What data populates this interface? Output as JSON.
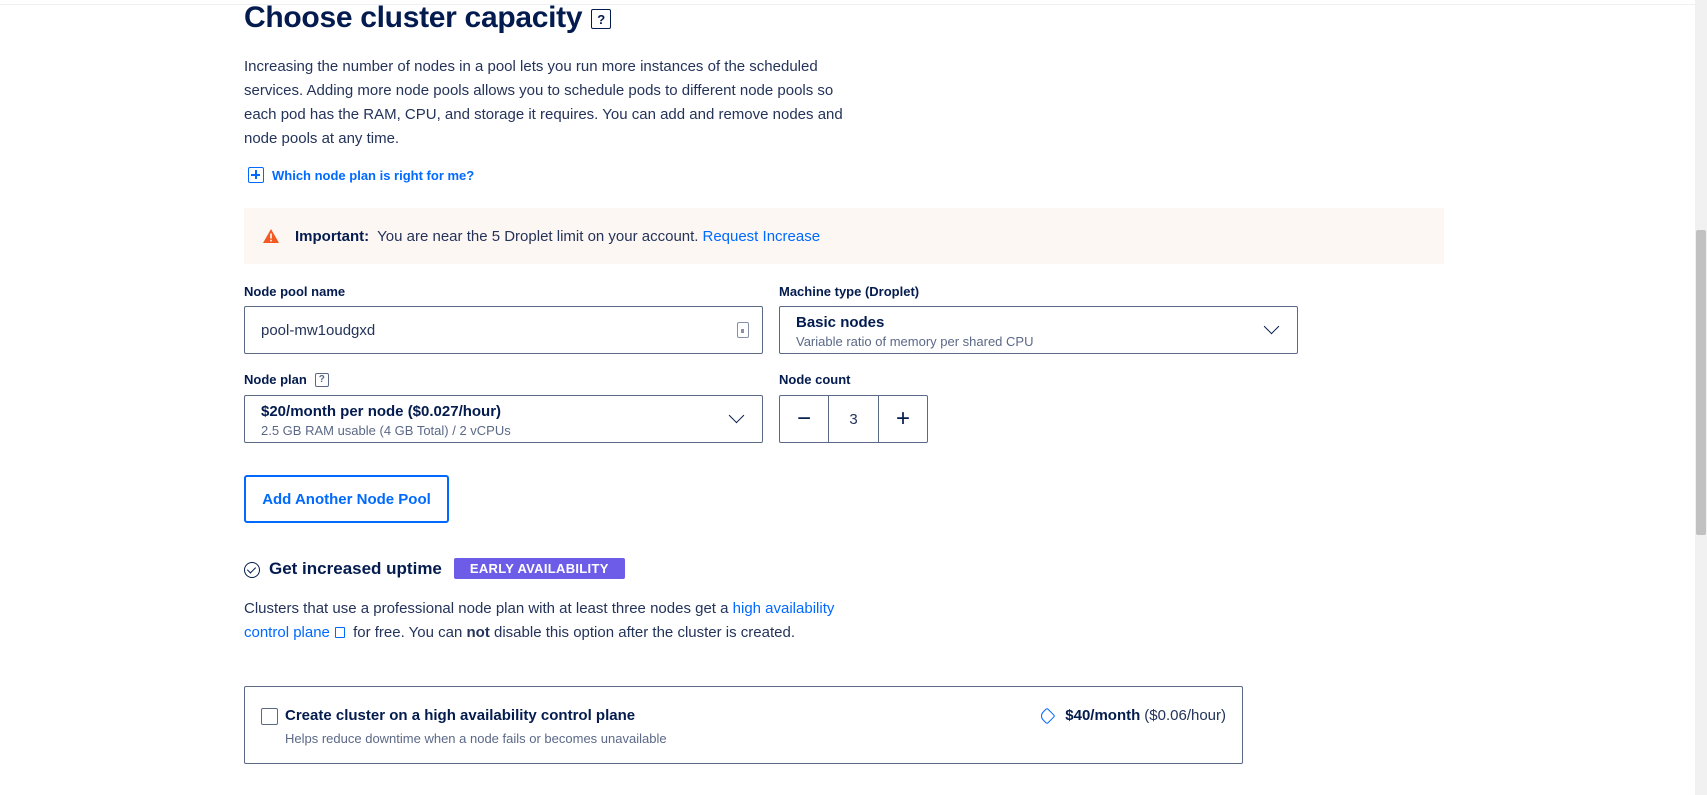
{
  "section": {
    "title": "Choose cluster capacity",
    "help_glyph": "?",
    "intro": "Increasing the number of nodes in a pool lets you run more instances of the scheduled services. Adding more node pools allows you to schedule pods to different node pools so each pod has the RAM, CPU, and storage it requires. You can add and remove nodes and node pools at any time.",
    "plan_help_link": "Which node plan is right for me?"
  },
  "alert": {
    "strong": "Important:",
    "message": "You are near the 5 Droplet limit on your account.",
    "link": "Request Increase"
  },
  "node_pool": {
    "name_label": "Node pool name",
    "name_value": "pool-mw1oudgxd",
    "machine_label": "Machine type (Droplet)",
    "machine_title": "Basic nodes",
    "machine_sub": "Variable ratio of memory per shared CPU",
    "plan_label": "Node plan",
    "plan_help_glyph": "?",
    "plan_title": "$20/month per node ($0.027/hour)",
    "plan_sub": "2.5 GB RAM usable (4 GB Total) / 2 vCPUs",
    "count_label": "Node count",
    "count_value": "3",
    "minus_glyph": "−",
    "plus_glyph": "+"
  },
  "add_pool_button": "Add Another Node Pool",
  "uptime": {
    "title": "Get increased uptime",
    "badge": "EARLY AVAILABILITY",
    "desc_1": "Clusters that use a professional node plan with at least three nodes get a ",
    "desc_link": "high availability control plane",
    "desc_2": " for free. You can ",
    "desc_bold": "not",
    "desc_3": " disable this option after the cluster is created."
  },
  "ha_option": {
    "checked": false,
    "title": "Create cluster on a high availability control plane",
    "sub": "Helps reduce downtime when a node fails or becomes unavailable",
    "price_month": "$40/month",
    "price_hour": "($0.06/hour)"
  },
  "colors": {
    "brand_blue": "#0069ff",
    "text_dark": "#031b4e",
    "warning": "#f15a22",
    "badge_purple": "#6c5ce7",
    "alert_bg": "#fdf7f3"
  },
  "icons": {
    "help": "help-icon",
    "expand": "plus-square-icon",
    "warning": "warning-icon",
    "chevron": "chevron-down-icon",
    "uptime": "check-circle-icon",
    "doc": "document-icon",
    "price": "tag-icon"
  }
}
